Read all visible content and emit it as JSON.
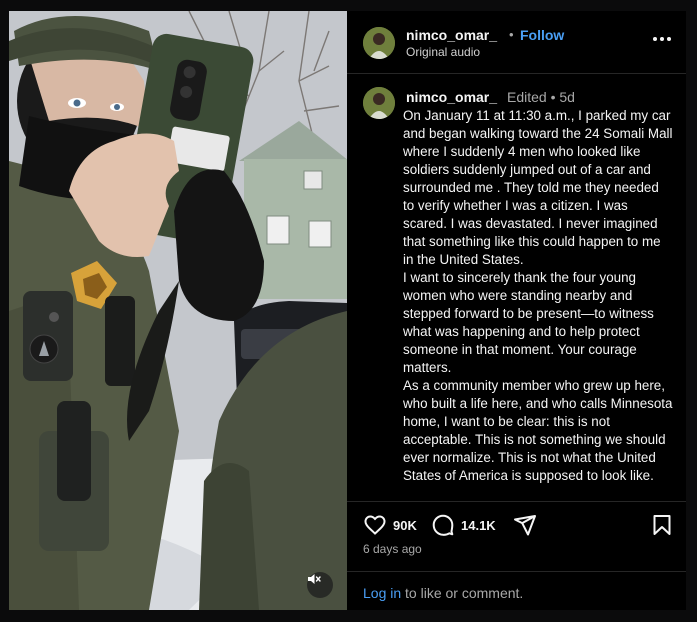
{
  "post": {
    "author": "nimco_omar_",
    "separator": "•",
    "follow_label": "Follow",
    "audio_label": "Original audio",
    "caption_author": "nimco_omar_",
    "edited_label": "Edited • 5d",
    "caption_text": "On January 11 at 11:30 a.m., I parked my car and began walking toward the 24 Somali Mall where I suddenly 4 men  who looked like soldiers suddenly jumped out of a car and surrounded me . They told me they needed to verify whether I was a citizen. I was scared. I was devastated. I never imagined that something like this could happen to me in the United States.\nI want to sincerely thank the four young women who were standing nearby and stepped forward to be present—to witness what was happening and to help protect someone in that moment. Your courage matters.\nAs a community member who grew up here, who built a life here, and who calls Minnesota home, I want to be clear: this is not acceptable. This is not something we should ever normalize. This is not what the United States of America is supposed to look like.",
    "likes": "90K",
    "comments": "14.1K",
    "time_ago": "6 days ago",
    "login_link": "Log in",
    "login_rest": " to like or comment."
  },
  "icons": {
    "like": "heart-icon",
    "comment": "comment-bubble-icon",
    "share": "paper-plane-icon",
    "save": "bookmark-icon",
    "more": "more-options-icon",
    "mute": "speaker-muted-icon"
  },
  "colors": {
    "background": "#000000",
    "text": "#f5f5f5",
    "secondary": "#a8a8a8",
    "link": "#4a9ff5",
    "divider": "#262626"
  }
}
